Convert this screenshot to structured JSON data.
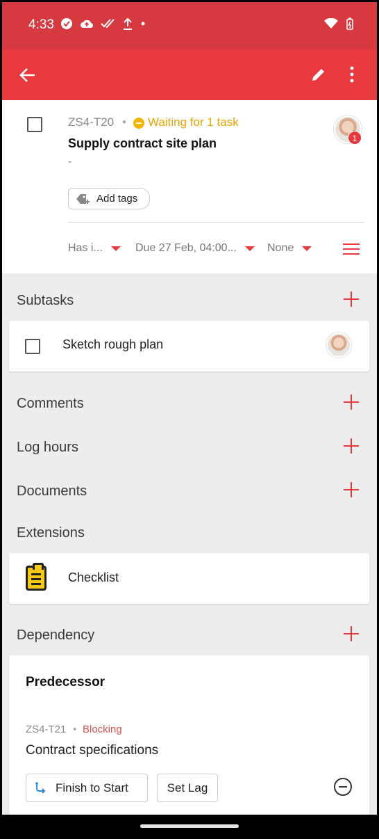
{
  "status_bar": {
    "time": "4:33",
    "icons": [
      "check-circle-icon",
      "cloud-upload-icon",
      "done-all-icon",
      "upload-icon",
      "dot-icon"
    ],
    "right_icons": [
      "wifi-icon",
      "battery-charging-icon"
    ]
  },
  "app_bar": {
    "icons": [
      "back-arrow-icon",
      "edit-pencil-icon",
      "more-vert-icon"
    ],
    "color": "#e8393f"
  },
  "task": {
    "id": "ZS4-T20",
    "separator": "•",
    "status": "Waiting for 1 task",
    "title": "Supply contract site plan",
    "description": "-",
    "add_tags_label": "Add tags",
    "assignee_badge": "1",
    "meta": {
      "status_value": "Has i...",
      "due_value": "Due 27 Feb, 04:00...",
      "priority_value": "None"
    }
  },
  "sections": {
    "subtasks": "Subtasks",
    "comments": "Comments",
    "log_hours": "Log hours",
    "documents": "Documents",
    "extensions": "Extensions",
    "dependency": "Dependency"
  },
  "subtasks": [
    {
      "title": "Sketch rough plan"
    }
  ],
  "extensions": [
    {
      "title": "Checklist",
      "icon": "clipboard-list-icon"
    }
  ],
  "dependency": {
    "heading": "Predecessor",
    "id": "ZS4-T21",
    "separator": "•",
    "status": "Blocking",
    "name": "Contract specifications",
    "type_label": "Finish to Start",
    "lag_label": "Set Lag"
  },
  "colors": {
    "accent": "#e8393f",
    "status_bar": "#d6393f",
    "waiting": "#e5a500",
    "blocking": "#d9534f"
  }
}
